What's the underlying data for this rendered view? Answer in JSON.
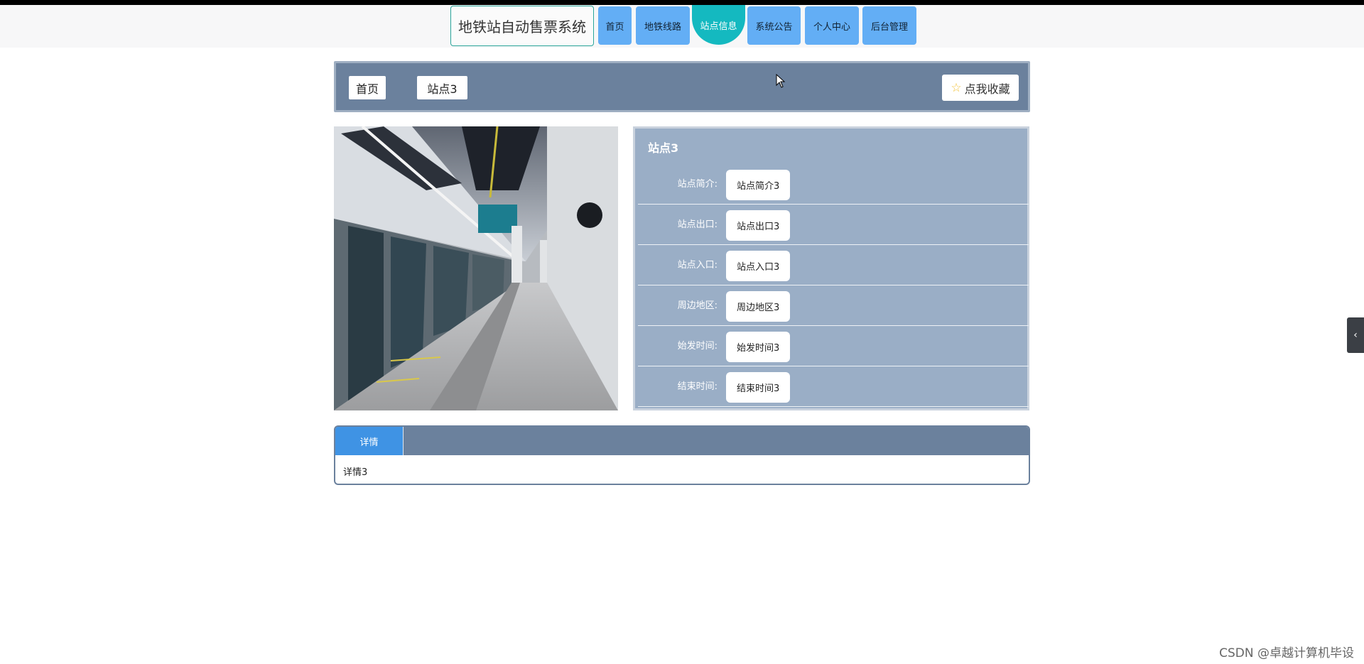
{
  "header": {
    "brand": "地铁站自动售票系统",
    "nav": [
      {
        "label": "首页",
        "active": false
      },
      {
        "label": "地铁线路",
        "active": false
      },
      {
        "label": "站点信息",
        "active": true
      },
      {
        "label": "系统公告",
        "active": false
      },
      {
        "label": "个人中心",
        "active": false
      },
      {
        "label": "后台管理",
        "active": false
      }
    ]
  },
  "breadcrumb": {
    "home": "首页",
    "current": "站点3"
  },
  "favorite": {
    "icon": "star-outline-icon",
    "label": "点我收藏"
  },
  "station": {
    "title": "站点3",
    "fields": [
      {
        "label": "站点简介:",
        "value": "站点简介3"
      },
      {
        "label": "站点出口:",
        "value": "站点出口3"
      },
      {
        "label": "站点入口:",
        "value": "站点入口3"
      },
      {
        "label": "周边地区:",
        "value": "周边地区3"
      },
      {
        "label": "始发时间:",
        "value": "始发时间3"
      },
      {
        "label": "结束时间:",
        "value": "结束时间3"
      }
    ]
  },
  "detail": {
    "tab": "详情",
    "content": "详情3"
  },
  "side_toggle_icon": "chevron-left-icon",
  "watermark": "CSDN @卓越计算机毕设",
  "colors": {
    "nav": "#63aef5",
    "nav_active": "#14b9c0",
    "panel": "#6b819d",
    "info_panel": "#9aaec6",
    "tab_active": "#3f93e4"
  }
}
